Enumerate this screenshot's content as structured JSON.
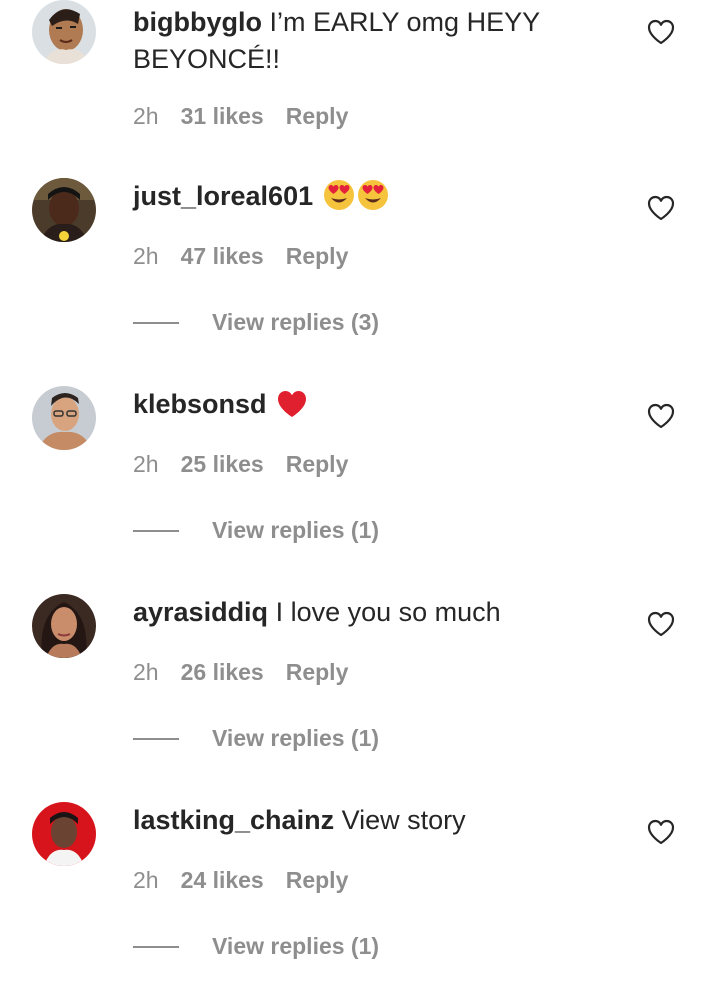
{
  "comments": [
    {
      "username": "bigbbyglo",
      "text": "I’m EARLY omg HEYY BEYONCÉ!!",
      "time": "2h",
      "likes": "31 likes",
      "reply": "Reply",
      "emoji": []
    },
    {
      "username": "just_loreal601",
      "text": "",
      "time": "2h",
      "likes": "47 likes",
      "reply": "Reply",
      "emoji": [
        "heart-eyes-emoji",
        "heart-eyes-emoji"
      ],
      "view_replies": "View replies (3)"
    },
    {
      "username": "klebsonsd",
      "text": "",
      "time": "2h",
      "likes": "25 likes",
      "reply": "Reply",
      "emoji": [
        "red-heart-emoji"
      ],
      "view_replies": "View replies (1)"
    },
    {
      "username": "ayrasiddiq",
      "text": "I love you so much",
      "time": "2h",
      "likes": "26 likes",
      "reply": "Reply",
      "emoji": [],
      "view_replies": "View replies (1)"
    },
    {
      "username": "lastking_chainz",
      "text": "View story",
      "time": "2h",
      "likes": "24 likes",
      "reply": "Reply",
      "emoji": [],
      "view_replies": "View replies (1)"
    }
  ],
  "icons": {
    "like": "heart-outline-icon"
  },
  "colors": {
    "text": "#262626",
    "secondary": "#8e8e8e",
    "heart_red": "#e0202e"
  }
}
